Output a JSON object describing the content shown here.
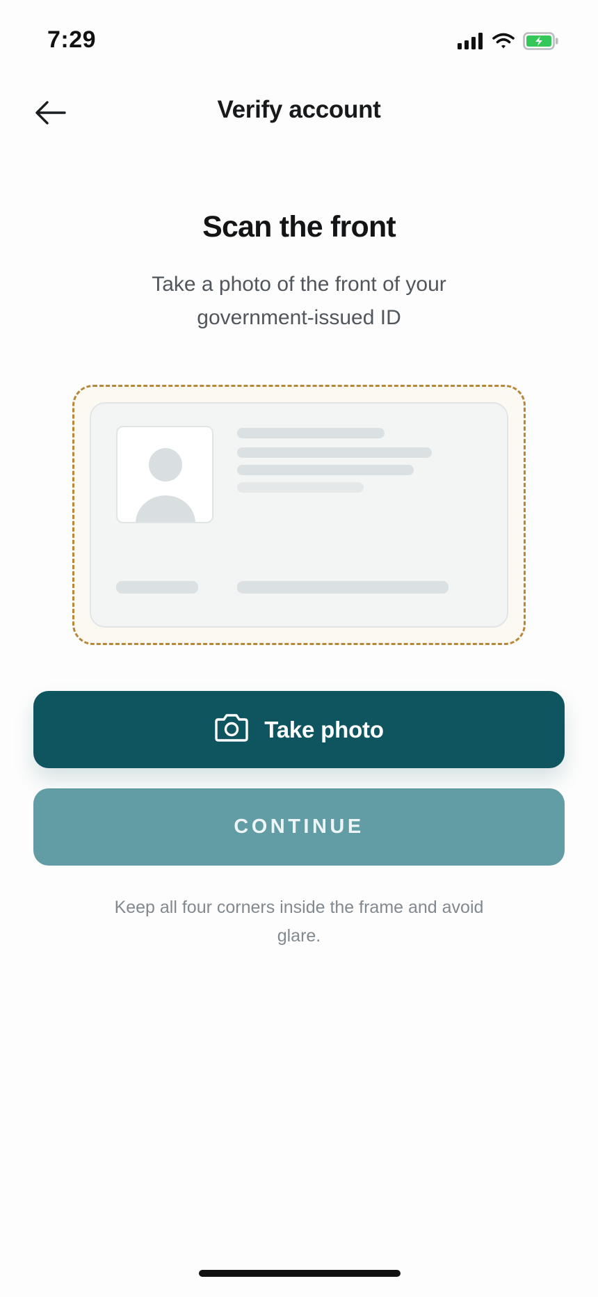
{
  "status_bar": {
    "time": "7:29",
    "icons": [
      "cellular-signal-icon",
      "wifi-icon",
      "battery-charging-icon"
    ],
    "battery_color": "#35c759"
  },
  "header": {
    "back_icon": "arrow-left-icon",
    "title": "Verify account"
  },
  "content": {
    "heading": "Scan the front",
    "subtitle": "Take a photo of the front of your government-issued ID",
    "frame_color": "#b7883b"
  },
  "buttons": {
    "take_photo": {
      "label": "Take photo",
      "icon": "camera-icon",
      "color": "#0e5560"
    },
    "continue": {
      "label": "CONTINUE",
      "color": "#629da5"
    }
  },
  "helper_text": "Keep all four corners inside the frame and avoid glare."
}
